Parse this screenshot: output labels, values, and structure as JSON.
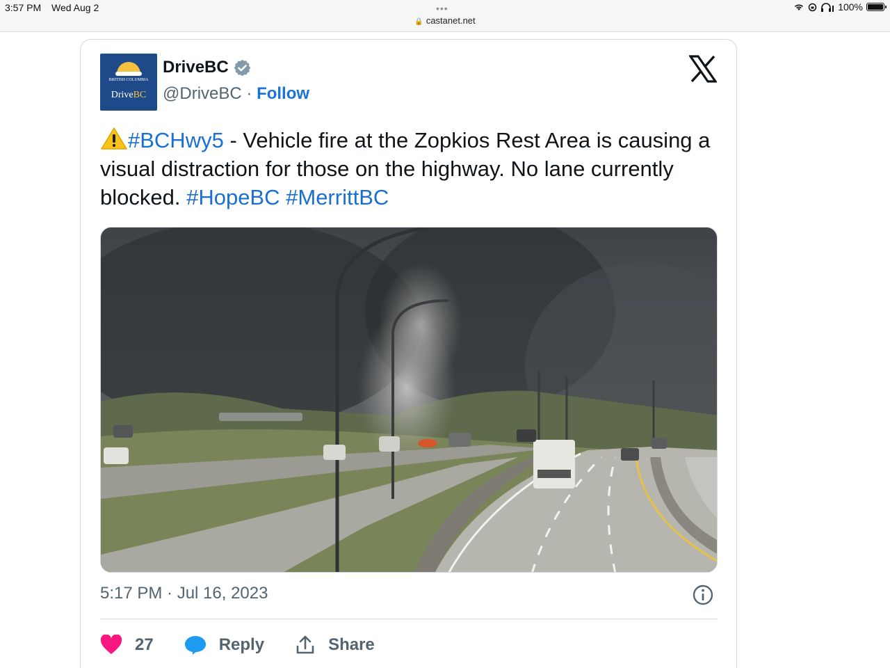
{
  "status_bar": {
    "time": "3:57 PM",
    "date": "Wed Aug 2",
    "battery": "100%",
    "url": "castanet.net"
  },
  "tweet": {
    "author_name": "DriveBC",
    "handle": "@DriveBC",
    "separator": "·",
    "follow_label": "Follow",
    "avatar_text_small": "BRITISH COLUMBIA",
    "avatar_text_drive": "Drive",
    "avatar_text_bc": "BC",
    "warning_emoji": "⚠️",
    "text": {
      "hashtag1": "#BCHwy5",
      "body": " - Vehicle fire at the Zopkios Rest Area is causing a visual distraction for those on the highway. No lane currently blocked. ",
      "hashtag2": "#HopeBC",
      "hashtag3": "#MerrittBC"
    },
    "timestamp": "5:17 PM · Jul 16, 2023",
    "likes": "27",
    "reply_label": "Reply",
    "share_label": "Share"
  },
  "colors": {
    "link_blue": "#1a6fd0",
    "heart_pink": "#f91880",
    "reply_blue": "#1d9bf0",
    "muted_gray": "#536471"
  },
  "icons": [
    "verified-badge-icon",
    "x-logo-icon",
    "warning-icon",
    "info-icon",
    "heart-icon",
    "reply-icon",
    "share-icon",
    "wifi-icon",
    "battery-icon"
  ]
}
